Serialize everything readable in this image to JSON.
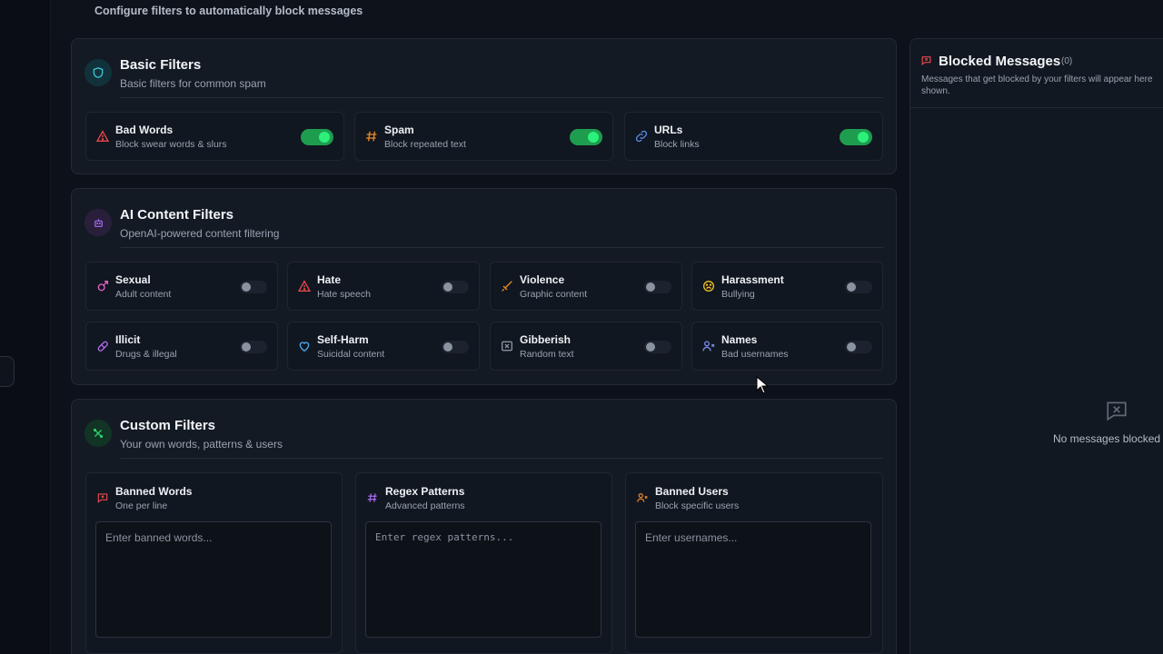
{
  "header": {
    "subtitle": "Configure filters to automatically block messages"
  },
  "basic": {
    "title": "Basic Filters",
    "subtitle": "Basic filters for common spam",
    "icon": "shield-icon",
    "items": [
      {
        "label": "Bad Words",
        "desc": "Block swear words & slurs",
        "icon": "warning-triangle-icon",
        "enabled": true
      },
      {
        "label": "Spam",
        "desc": "Block repeated text",
        "icon": "hash-icon",
        "enabled": true
      },
      {
        "label": "URLs",
        "desc": "Block links",
        "icon": "link-icon",
        "enabled": true
      }
    ]
  },
  "ai": {
    "title": "AI Content Filters",
    "subtitle": "OpenAI-powered content filtering",
    "icon": "bot-icon",
    "items": [
      {
        "label": "Sexual",
        "desc": "Adult content",
        "icon": "gender-icon",
        "enabled": false
      },
      {
        "label": "Hate",
        "desc": "Hate speech",
        "icon": "warning-triangle-icon",
        "enabled": false
      },
      {
        "label": "Violence",
        "desc": "Graphic content",
        "icon": "sword-icon",
        "enabled": false
      },
      {
        "label": "Harassment",
        "desc": "Bullying",
        "icon": "angry-face-icon",
        "enabled": false
      },
      {
        "label": "Illicit",
        "desc": "Drugs & illegal",
        "icon": "pill-icon",
        "enabled": false
      },
      {
        "label": "Self-Harm",
        "desc": "Suicidal content",
        "icon": "heart-icon",
        "enabled": false
      },
      {
        "label": "Gibberish",
        "desc": "Random text",
        "icon": "text-box-icon",
        "enabled": false
      },
      {
        "label": "Names",
        "desc": "Bad usernames",
        "icon": "user-x-icon",
        "enabled": false
      }
    ]
  },
  "custom": {
    "title": "Custom Filters",
    "subtitle": "Your own words, patterns & users",
    "icon": "sparkle-icon",
    "items": [
      {
        "label": "Banned Words",
        "desc": "One per line",
        "placeholder": "Enter banned words...",
        "icon": "message-x-icon"
      },
      {
        "label": "Regex Patterns",
        "desc": "Advanced patterns",
        "placeholder": "Enter regex patterns...",
        "icon": "hash-icon"
      },
      {
        "label": "Banned Users",
        "desc": "Block specific users",
        "placeholder": "Enter usernames...",
        "icon": "user-x-icon"
      }
    ]
  },
  "blocked": {
    "title": "Blocked Messages",
    "count": "(0)",
    "desc": "Messages that get blocked by your filters will appear here shown.",
    "empty": "No messages blocked",
    "icon": "message-x-icon"
  },
  "colors": {
    "accent_green": "#2cf07a",
    "danger": "#e5484d",
    "orange": "#f08a24",
    "blue": "#5b8def",
    "purple": "#a56cf0"
  }
}
